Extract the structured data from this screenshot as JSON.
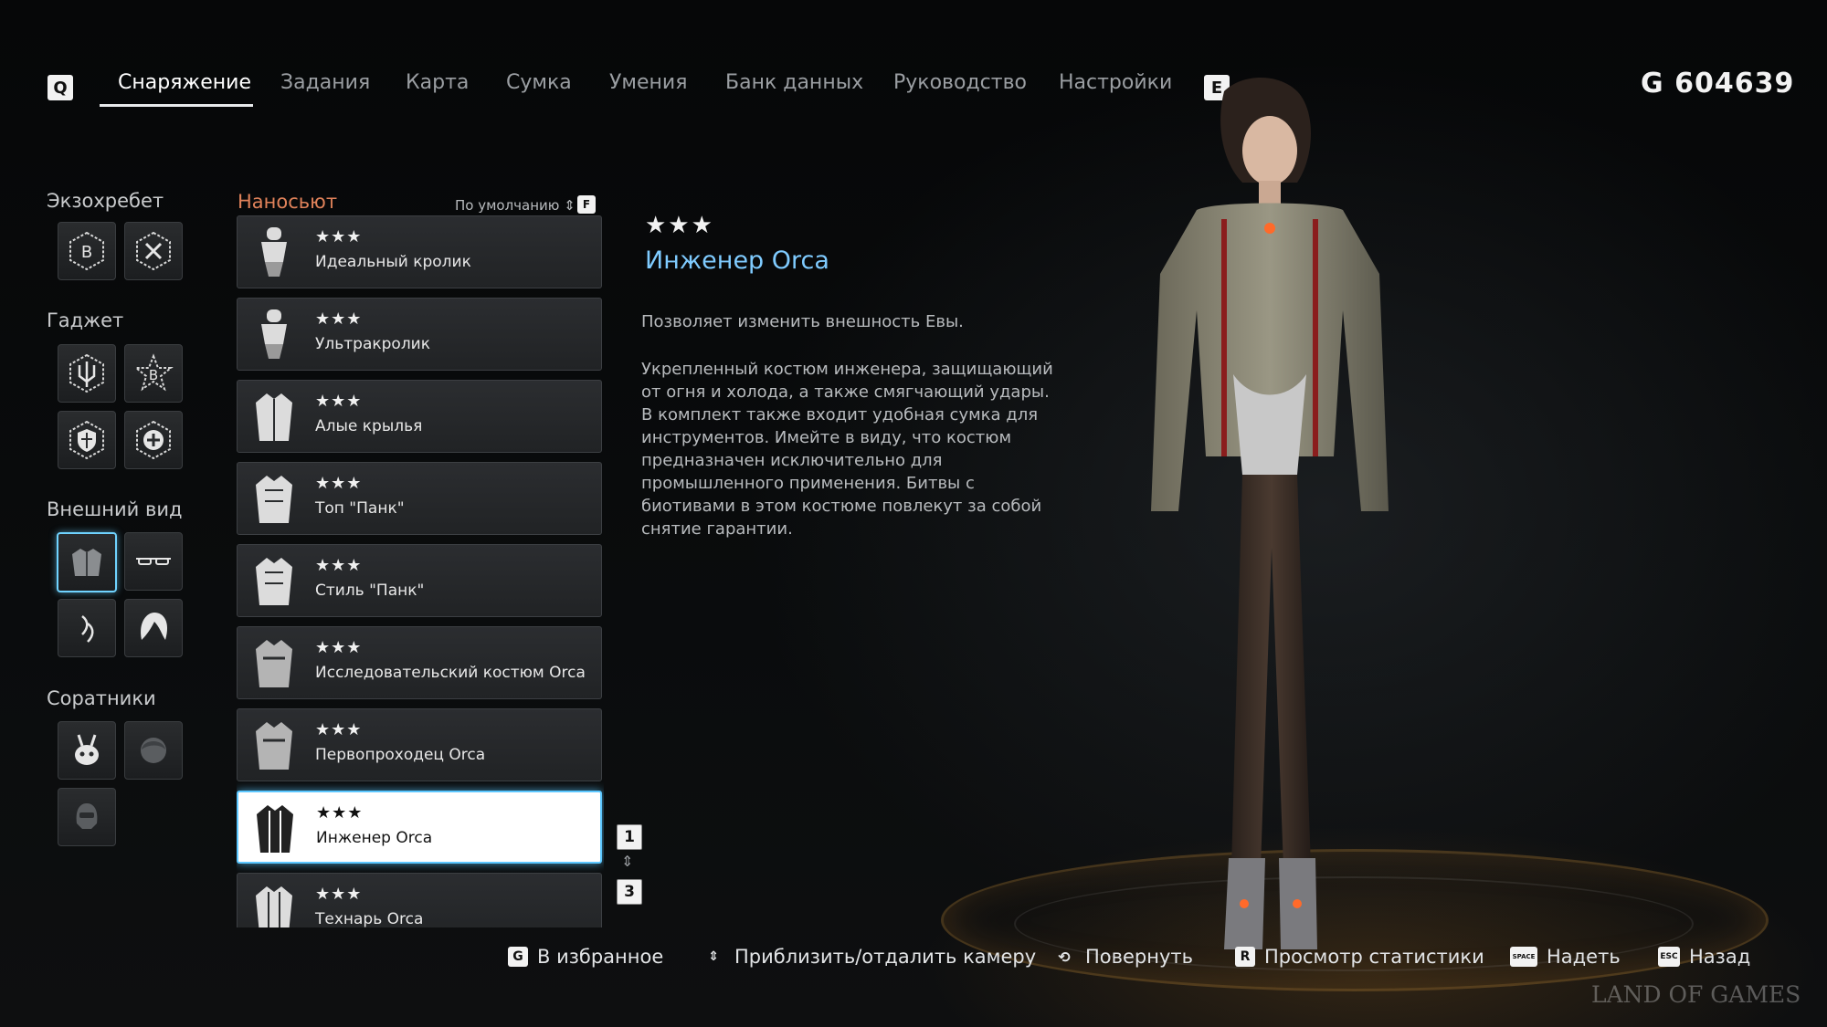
{
  "nav": {
    "left_key": "Q",
    "right_key": "E",
    "tabs": [
      {
        "label": "Снаряжение",
        "active": true
      },
      {
        "label": "Задания",
        "active": false
      },
      {
        "label": "Карта",
        "active": false
      },
      {
        "label": "Сумка",
        "active": false
      },
      {
        "label": "Умения",
        "active": false
      },
      {
        "label": "Банк данных",
        "active": false
      },
      {
        "label": "Руководство",
        "active": false
      },
      {
        "label": "Настройки",
        "active": false
      }
    ],
    "currency": "G  604639"
  },
  "categories": {
    "exospine": "Экзохребет",
    "gadget": "Гаджет",
    "appearance": "Внешний вид",
    "companions": "Соратники"
  },
  "list": {
    "header": "Наносьют",
    "sort_label": "По умолчанию",
    "sort_key": "F",
    "items": [
      {
        "stars": "★★★",
        "name": "Идеальный кролик"
      },
      {
        "stars": "★★★",
        "name": "Ультракролик"
      },
      {
        "stars": "★★★",
        "name": "Алые крылья"
      },
      {
        "stars": "★★★",
        "name": "Топ \"Панк\""
      },
      {
        "stars": "★★★",
        "name": "Стиль \"Панк\""
      },
      {
        "stars": "★★★",
        "name": "Исследовательский костюм Orca"
      },
      {
        "stars": "★★★",
        "name": "Первопроходец Orca"
      },
      {
        "stars": "★★★",
        "name": "Инженер Orca"
      },
      {
        "stars": "★★★",
        "name": "Технарь Orca"
      }
    ],
    "selected_index": 7,
    "page_key_top": "1",
    "page_key_bottom": "3"
  },
  "detail": {
    "stars": "★★★",
    "title": "Инженер Orca",
    "short": "Позволяет изменить внешность Евы.",
    "long": "Укрепленный костюм инженера, защищающий от огня и холода, а также смягчающий удары. В комплект также входит удобная сумка для инструментов. Имейте в виду, что костюм предназначен исключительно для промышленного применения. Битвы с биотивами в этом костюме повлекут за собой снятие гарантии."
  },
  "hints": [
    {
      "key": "G",
      "label": "В избранное"
    },
    {
      "key": "⇕",
      "label": "Приблизить/отдалить камеру"
    },
    {
      "key": "⟲",
      "label": "Повернуть"
    },
    {
      "key": "R",
      "label": "Просмотр статистики"
    },
    {
      "key": "SPACE",
      "label": "Надеть"
    },
    {
      "key": "ESC",
      "label": "Назад"
    }
  ],
  "watermark": "LAND OF GAMES",
  "colors": {
    "accent_blue": "#6fd3ff",
    "title_blue": "#7fcbff",
    "list_header_orange": "#e0825a"
  }
}
